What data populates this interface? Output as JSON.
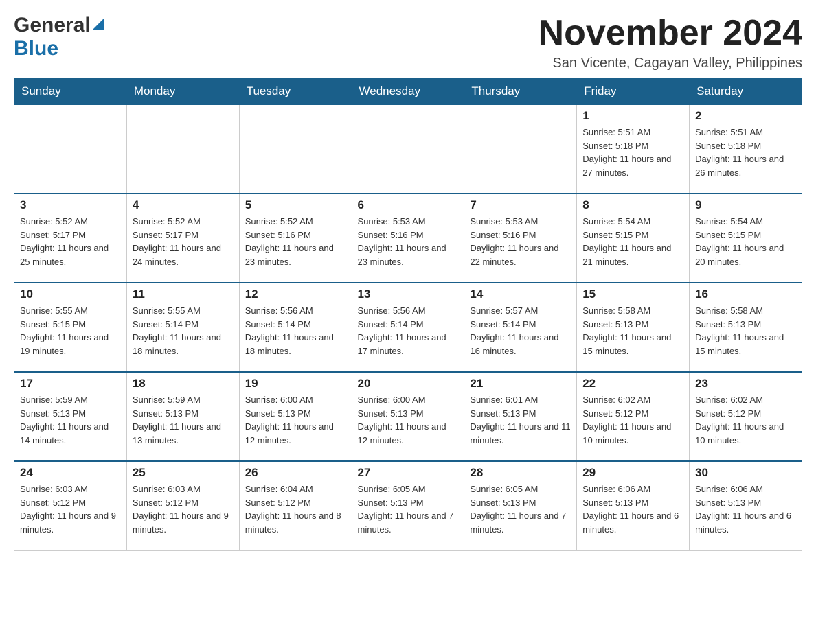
{
  "logo": {
    "general": "General",
    "blue": "Blue",
    "triangle": "▲"
  },
  "header": {
    "month_year": "November 2024",
    "location": "San Vicente, Cagayan Valley, Philippines"
  },
  "weekdays": [
    "Sunday",
    "Monday",
    "Tuesday",
    "Wednesday",
    "Thursday",
    "Friday",
    "Saturday"
  ],
  "weeks": [
    [
      {
        "day": "",
        "info": ""
      },
      {
        "day": "",
        "info": ""
      },
      {
        "day": "",
        "info": ""
      },
      {
        "day": "",
        "info": ""
      },
      {
        "day": "",
        "info": ""
      },
      {
        "day": "1",
        "info": "Sunrise: 5:51 AM\nSunset: 5:18 PM\nDaylight: 11 hours and 27 minutes."
      },
      {
        "day": "2",
        "info": "Sunrise: 5:51 AM\nSunset: 5:18 PM\nDaylight: 11 hours and 26 minutes."
      }
    ],
    [
      {
        "day": "3",
        "info": "Sunrise: 5:52 AM\nSunset: 5:17 PM\nDaylight: 11 hours and 25 minutes."
      },
      {
        "day": "4",
        "info": "Sunrise: 5:52 AM\nSunset: 5:17 PM\nDaylight: 11 hours and 24 minutes."
      },
      {
        "day": "5",
        "info": "Sunrise: 5:52 AM\nSunset: 5:16 PM\nDaylight: 11 hours and 23 minutes."
      },
      {
        "day": "6",
        "info": "Sunrise: 5:53 AM\nSunset: 5:16 PM\nDaylight: 11 hours and 23 minutes."
      },
      {
        "day": "7",
        "info": "Sunrise: 5:53 AM\nSunset: 5:16 PM\nDaylight: 11 hours and 22 minutes."
      },
      {
        "day": "8",
        "info": "Sunrise: 5:54 AM\nSunset: 5:15 PM\nDaylight: 11 hours and 21 minutes."
      },
      {
        "day": "9",
        "info": "Sunrise: 5:54 AM\nSunset: 5:15 PM\nDaylight: 11 hours and 20 minutes."
      }
    ],
    [
      {
        "day": "10",
        "info": "Sunrise: 5:55 AM\nSunset: 5:15 PM\nDaylight: 11 hours and 19 minutes."
      },
      {
        "day": "11",
        "info": "Sunrise: 5:55 AM\nSunset: 5:14 PM\nDaylight: 11 hours and 18 minutes."
      },
      {
        "day": "12",
        "info": "Sunrise: 5:56 AM\nSunset: 5:14 PM\nDaylight: 11 hours and 18 minutes."
      },
      {
        "day": "13",
        "info": "Sunrise: 5:56 AM\nSunset: 5:14 PM\nDaylight: 11 hours and 17 minutes."
      },
      {
        "day": "14",
        "info": "Sunrise: 5:57 AM\nSunset: 5:14 PM\nDaylight: 11 hours and 16 minutes."
      },
      {
        "day": "15",
        "info": "Sunrise: 5:58 AM\nSunset: 5:13 PM\nDaylight: 11 hours and 15 minutes."
      },
      {
        "day": "16",
        "info": "Sunrise: 5:58 AM\nSunset: 5:13 PM\nDaylight: 11 hours and 15 minutes."
      }
    ],
    [
      {
        "day": "17",
        "info": "Sunrise: 5:59 AM\nSunset: 5:13 PM\nDaylight: 11 hours and 14 minutes."
      },
      {
        "day": "18",
        "info": "Sunrise: 5:59 AM\nSunset: 5:13 PM\nDaylight: 11 hours and 13 minutes."
      },
      {
        "day": "19",
        "info": "Sunrise: 6:00 AM\nSunset: 5:13 PM\nDaylight: 11 hours and 12 minutes."
      },
      {
        "day": "20",
        "info": "Sunrise: 6:00 AM\nSunset: 5:13 PM\nDaylight: 11 hours and 12 minutes."
      },
      {
        "day": "21",
        "info": "Sunrise: 6:01 AM\nSunset: 5:13 PM\nDaylight: 11 hours and 11 minutes."
      },
      {
        "day": "22",
        "info": "Sunrise: 6:02 AM\nSunset: 5:12 PM\nDaylight: 11 hours and 10 minutes."
      },
      {
        "day": "23",
        "info": "Sunrise: 6:02 AM\nSunset: 5:12 PM\nDaylight: 11 hours and 10 minutes."
      }
    ],
    [
      {
        "day": "24",
        "info": "Sunrise: 6:03 AM\nSunset: 5:12 PM\nDaylight: 11 hours and 9 minutes."
      },
      {
        "day": "25",
        "info": "Sunrise: 6:03 AM\nSunset: 5:12 PM\nDaylight: 11 hours and 9 minutes."
      },
      {
        "day": "26",
        "info": "Sunrise: 6:04 AM\nSunset: 5:12 PM\nDaylight: 11 hours and 8 minutes."
      },
      {
        "day": "27",
        "info": "Sunrise: 6:05 AM\nSunset: 5:13 PM\nDaylight: 11 hours and 7 minutes."
      },
      {
        "day": "28",
        "info": "Sunrise: 6:05 AM\nSunset: 5:13 PM\nDaylight: 11 hours and 7 minutes."
      },
      {
        "day": "29",
        "info": "Sunrise: 6:06 AM\nSunset: 5:13 PM\nDaylight: 11 hours and 6 minutes."
      },
      {
        "day": "30",
        "info": "Sunrise: 6:06 AM\nSunset: 5:13 PM\nDaylight: 11 hours and 6 minutes."
      }
    ]
  ]
}
